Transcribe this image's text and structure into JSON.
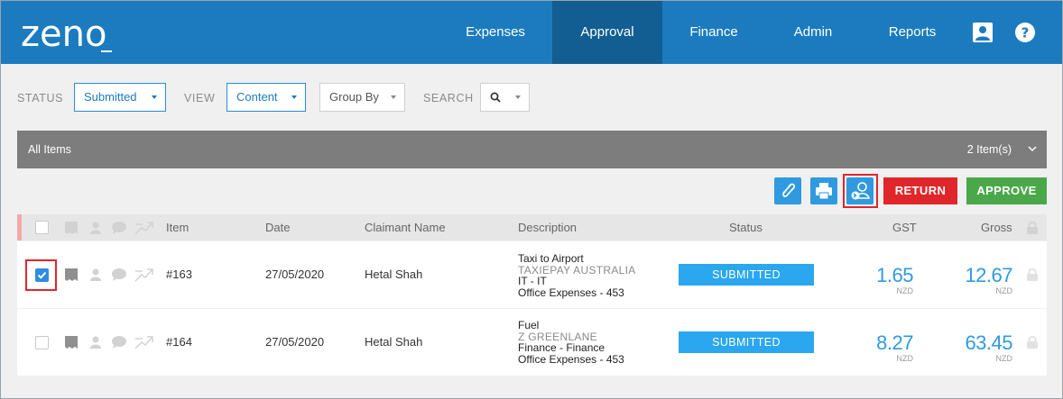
{
  "app": {
    "logo_text": "zeno"
  },
  "nav": {
    "items": [
      {
        "label": "Expenses",
        "active": false
      },
      {
        "label": "Approval",
        "active": true
      },
      {
        "label": "Finance",
        "active": false
      },
      {
        "label": "Admin",
        "active": false
      },
      {
        "label": "Reports",
        "active": false
      }
    ],
    "icons": [
      "user-icon",
      "help-icon"
    ]
  },
  "filters": {
    "status_label": "STATUS",
    "status_value": "Submitted",
    "view_label": "VIEW",
    "view_value": "Content",
    "group_by_value": "Group By",
    "search_label": "SEARCH"
  },
  "group": {
    "title": "All Items",
    "count": "2 Item(s)"
  },
  "actions": {
    "attach_icon": "paperclip-icon",
    "print_icon": "printer-icon",
    "forward_icon": "forward-user-icon",
    "return_label": "RETURN",
    "approve_label": "APPROVE"
  },
  "table": {
    "headers": {
      "item": "Item",
      "date": "Date",
      "claimant": "Claimant Name",
      "description": "Description",
      "status": "Status",
      "gst": "GST",
      "gross": "Gross"
    },
    "rows": [
      {
        "checked": true,
        "item": "#163",
        "date": "27/05/2020",
        "claimant": "Hetal Shah",
        "desc_title": "Taxi to Airport",
        "desc_merchant": "TAXIEPAY AUSTRALIA",
        "desc_dept": "IT - IT",
        "desc_account": "Office Expenses - 453",
        "status": "SUBMITTED",
        "gst": "1.65",
        "gst_currency": "NZD",
        "gross": "12.67",
        "gross_currency": "NZD"
      },
      {
        "checked": false,
        "item": "#164",
        "date": "27/05/2020",
        "claimant": "Hetal Shah",
        "desc_title": "Fuel",
        "desc_merchant": "Z GREENLANE",
        "desc_dept": "Finance - Finance",
        "desc_account": "Office Expenses - 453",
        "status": "SUBMITTED",
        "gst": "8.27",
        "gst_currency": "NZD",
        "gross": "63.45",
        "gross_currency": "NZD"
      }
    ]
  },
  "colors": {
    "brand": "#1c7bbf",
    "nav_active": "#125e92",
    "status_submitted": "#2aa7ee",
    "return": "#e0262b",
    "approve": "#4ba84a",
    "amount": "#2f9ae0"
  }
}
